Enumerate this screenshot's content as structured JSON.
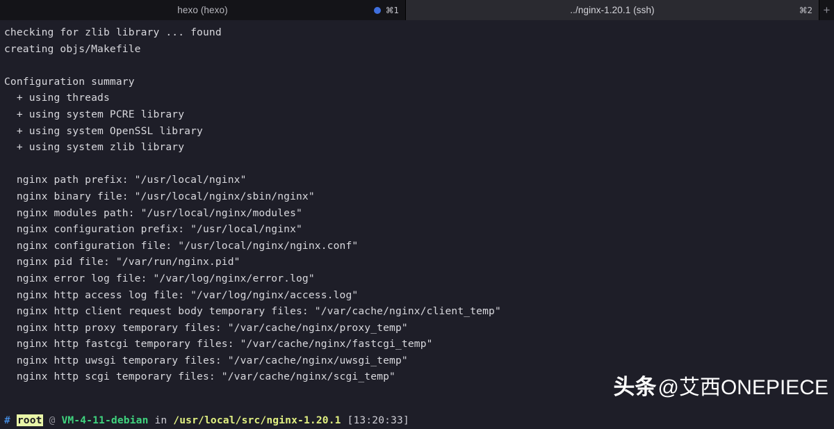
{
  "tabs": [
    {
      "title": "hexo (hexo)",
      "shortcut": "⌘1",
      "active": false,
      "has_dot": true,
      "dot_color": "#3f6fde"
    },
    {
      "title": "../nginx-1.20.1 (ssh)",
      "shortcut": "⌘2",
      "active": true,
      "has_dot": false
    }
  ],
  "new_tab_label": "+",
  "terminal": {
    "lines": [
      "checking for zlib library ... found",
      "creating objs/Makefile",
      "",
      "Configuration summary",
      "  + using threads",
      "  + using system PCRE library",
      "  + using system OpenSSL library",
      "  + using system zlib library",
      "",
      "  nginx path prefix: \"/usr/local/nginx\"",
      "  nginx binary file: \"/usr/local/nginx/sbin/nginx\"",
      "  nginx modules path: \"/usr/local/nginx/modules\"",
      "  nginx configuration prefix: \"/usr/local/nginx\"",
      "  nginx configuration file: \"/usr/local/nginx/nginx.conf\"",
      "  nginx pid file: \"/var/run/nginx.pid\"",
      "  nginx error log file: \"/var/log/nginx/error.log\"",
      "  nginx http access log file: \"/var/log/nginx/access.log\"",
      "  nginx http client request body temporary files: \"/var/cache/nginx/client_temp\"",
      "  nginx http proxy temporary files: \"/var/cache/nginx/proxy_temp\"",
      "  nginx http fastcgi temporary files: \"/var/cache/nginx/fastcgi_temp\"",
      "  nginx http uwsgi temporary files: \"/var/cache/nginx/uwsgi_temp\"",
      "  nginx http scgi temporary files: \"/var/cache/nginx/scgi_temp\""
    ]
  },
  "prompt": {
    "symbol": "#",
    "user": "root",
    "separator": "@",
    "host": "VM-4-11-debian",
    "preposition": "in",
    "path": "/usr/local/src/nginx-1.20.1",
    "timestamp": "[13:20:33]"
  },
  "watermark": {
    "brand": "头条",
    "handle": "@艾西ONEPIECE"
  },
  "colors": {
    "terminal_bg": "#1e1e28",
    "tabbar_bg": "#141418",
    "active_tab_bg": "#2a2a30",
    "text": "#d9d9de",
    "prompt_hash": "#4a9eff",
    "prompt_user_bg": "#e9f5a8",
    "prompt_host": "#3fd37e",
    "prompt_path": "#e0ef81"
  }
}
